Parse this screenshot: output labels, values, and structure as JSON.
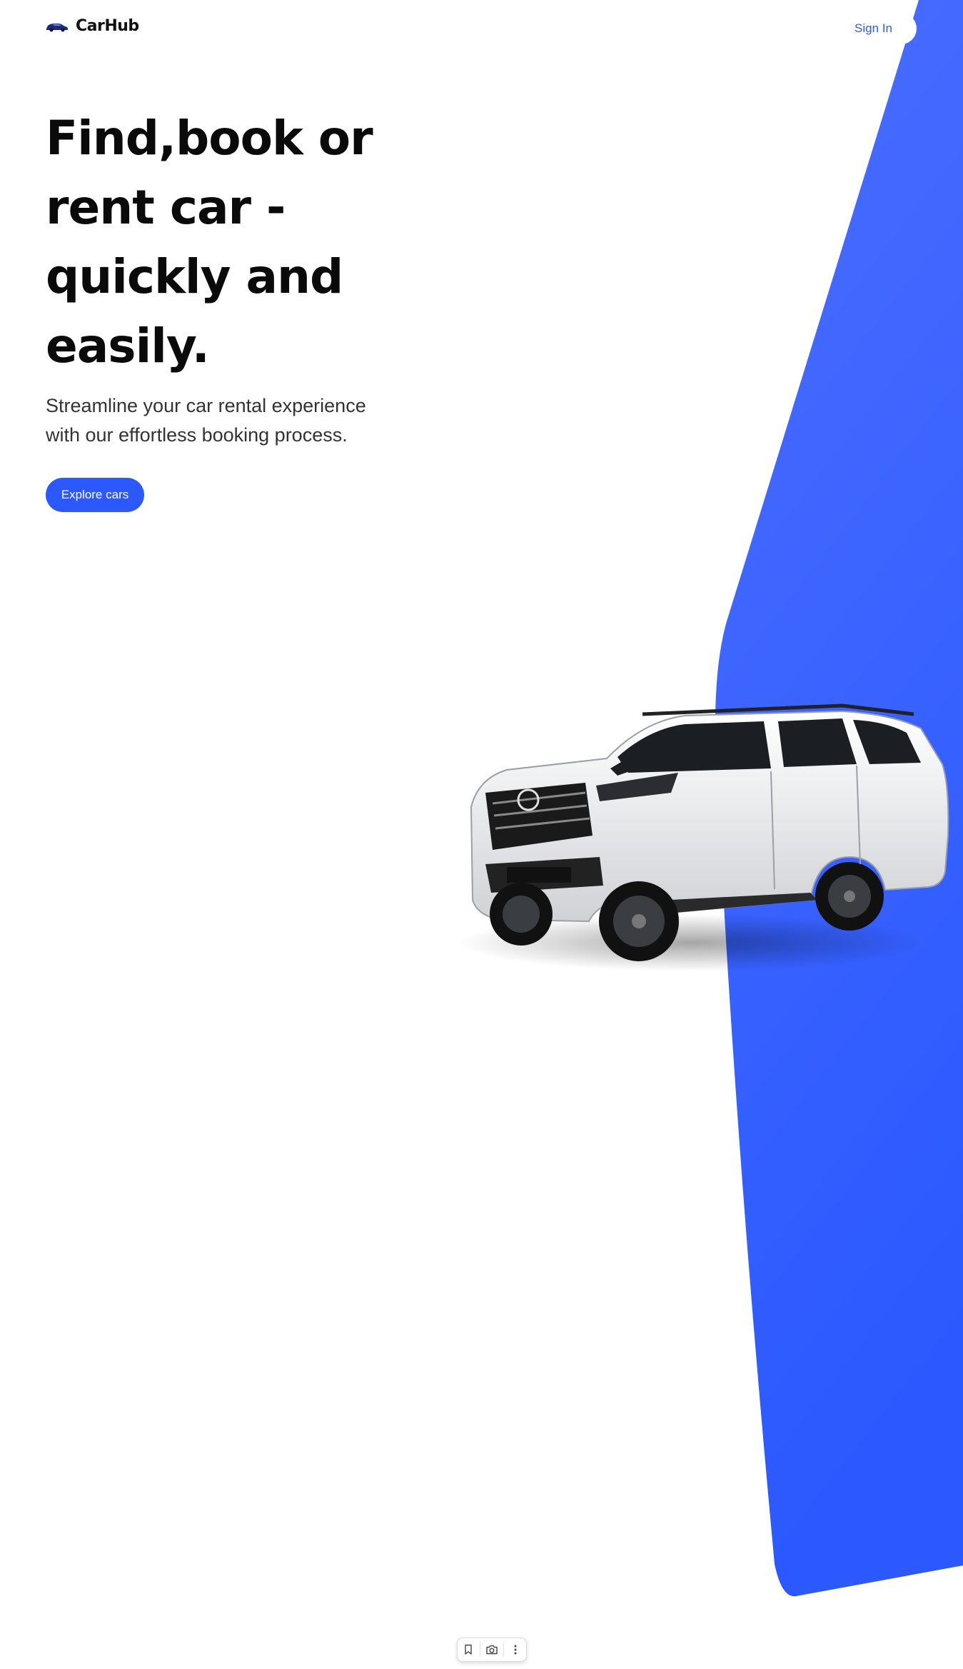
{
  "brand": {
    "name": "CarHub",
    "accent_color": "#2b59ff",
    "logo_icon": "car-icon"
  },
  "nav": {
    "signin_label": "Sign In"
  },
  "hero": {
    "title_lines": [
      "Find,book or",
      "rent car -",
      "quickly and",
      "easily."
    ],
    "subtitle_lines": [
      "Streamline your car rental experience",
      "with our effortless booking process."
    ],
    "cta_label": "Explore cars",
    "image": "car-hero-image"
  },
  "toolbar": {
    "icons": [
      "bookmark-icon",
      "camera-icon",
      "more-vertical-icon"
    ]
  }
}
